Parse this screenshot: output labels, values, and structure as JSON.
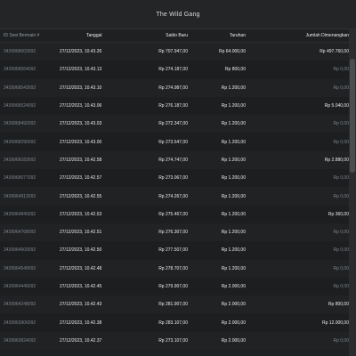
{
  "window": {
    "title": "The Wild Gang"
  },
  "columns": [
    "ID Sesi Bermain #",
    "Tanggal",
    "Saldo Baru",
    "Taruhan",
    "Jumlah Dimenangkan"
  ],
  "rows": [
    {
      "id": "3439968603092",
      "date": "27/12/2023, 10.43.26",
      "balance": "Rp 707.947,00",
      "bet": "Rp 64.000,00",
      "win": "Rp 497.760,00"
    },
    {
      "id": "3439968564092",
      "date": "27/12/2023, 10.43.13",
      "balance": "Rp 274.187,00",
      "bet": "Rp 800,00",
      "win": "Rp 0,00"
    },
    {
      "id": "3439968543092",
      "date": "27/12/2023, 10.43.10",
      "balance": "Rp 274.987,00",
      "bet": "Rp 1.200,00",
      "win": "Rp 0,00"
    },
    {
      "id": "3439968524092",
      "date": "27/12/2023, 10.43.06",
      "balance": "Rp 276.187,00",
      "bet": "Rp 1.200,00",
      "win": "Rp 5.040,00"
    },
    {
      "id": "3439968492092",
      "date": "27/12/2023, 10.43.03",
      "balance": "Rp 272.347,00",
      "bet": "Rp 1.200,00",
      "win": "Rp 0,00"
    },
    {
      "id": "3439968290092",
      "date": "27/12/2023, 10.43.00",
      "balance": "Rp 273.547,00",
      "bet": "Rp 1.200,00",
      "win": "Rp 0,00"
    },
    {
      "id": "3439968183092",
      "date": "27/12/2023, 10.42.58",
      "balance": "Rp 274.747,00",
      "bet": "Rp 1.200,00",
      "win": "Rp 2.880,00"
    },
    {
      "id": "3439968077092",
      "date": "27/12/2023, 10.42.57",
      "balance": "Rp 273.067,00",
      "bet": "Rp 1.200,00",
      "win": "Rp 0,00"
    },
    {
      "id": "3439964913092",
      "date": "27/12/2023, 10.42.55",
      "balance": "Rp 274.267,00",
      "bet": "Rp 1.200,00",
      "win": "Rp 0,00"
    },
    {
      "id": "3439964840092",
      "date": "27/12/2023, 10.42.53",
      "balance": "Rp 275.467,00",
      "bet": "Rp 1.200,00",
      "win": "Rp 360,00"
    },
    {
      "id": "3439964768092",
      "date": "27/12/2023, 10.42.51",
      "balance": "Rp 276.307,00",
      "bet": "Rp 1.200,00",
      "win": "Rp 0,00"
    },
    {
      "id": "3439964609092",
      "date": "27/12/2023, 10.42.50",
      "balance": "Rp 277.507,00",
      "bet": "Rp 1.200,00",
      "win": "Rp 0,00"
    },
    {
      "id": "3439964549092",
      "date": "27/12/2023, 10.42.48",
      "balance": "Rp 278.707,00",
      "bet": "Rp 1.200,00",
      "win": "Rp 0,00"
    },
    {
      "id": "3439964449092",
      "date": "27/12/2023, 10.42.45",
      "balance": "Rp 279.907,00",
      "bet": "Rp 2.000,00",
      "win": "Rp 0,00"
    },
    {
      "id": "3439964248092",
      "date": "27/12/2023, 10.42.43",
      "balance": "Rp 281.907,00",
      "bet": "Rp 2.000,00",
      "win": "Rp 800,00"
    },
    {
      "id": "3439963906092",
      "date": "27/12/2023, 10.42.38",
      "balance": "Rp 283.107,00",
      "bet": "Rp 2.000,00",
      "win": "Rp 12.000,00"
    },
    {
      "id": "3439963824092",
      "date": "27/12/2023, 10.42.37",
      "balance": "Rp 273.107,00",
      "bet": "Rp 2.000,00",
      "win": "Rp 0,00"
    }
  ],
  "colors": {
    "background": "#1e2022",
    "text": "#ededed",
    "muted": "#7f858b"
  }
}
